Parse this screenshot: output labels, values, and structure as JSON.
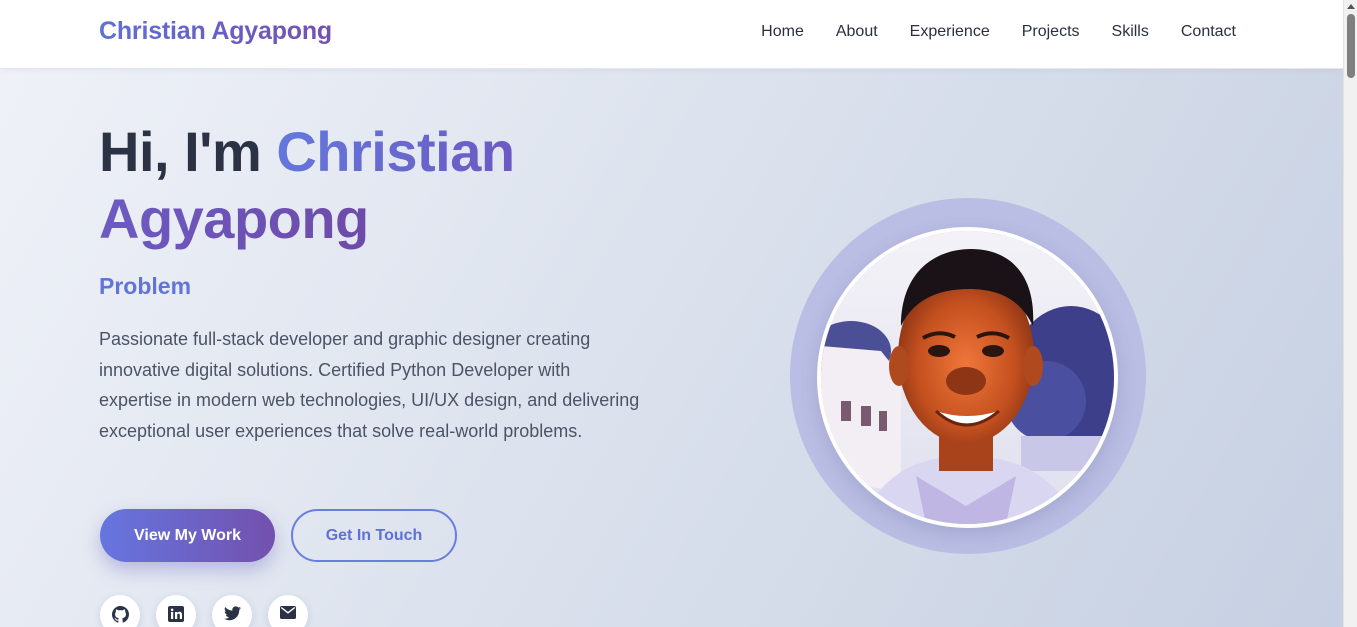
{
  "brand": "Christian Agyapong",
  "nav": [
    "Home",
    "About",
    "Experience",
    "Projects",
    "Skills",
    "Contact"
  ],
  "hero": {
    "greeting": "Hi, I'm",
    "name": "Christian Agyapong",
    "role": "Problem",
    "description": "Passionate full-stack developer and graphic designer creating innovative digital solutions. Certified Python Developer with expertise in modern web technologies, UI/UX design, and delivering exceptional user experiences that solve real-world problems.",
    "primary_button": "View My Work",
    "secondary_button": "Get In Touch"
  },
  "socials": [
    {
      "icon": "github-icon"
    },
    {
      "icon": "linkedin-icon"
    },
    {
      "icon": "twitter-icon"
    },
    {
      "icon": "email-icon"
    }
  ],
  "colors": {
    "accent_start": "#6676e0",
    "accent_end": "#7350ad",
    "text_dark": "#2b3243",
    "text_body": "#4b5466"
  }
}
